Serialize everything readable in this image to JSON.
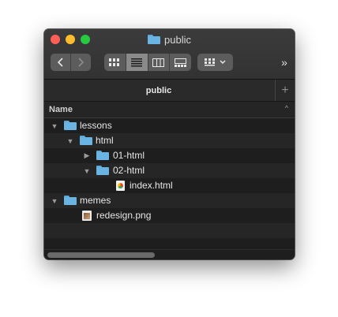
{
  "window": {
    "title": "public"
  },
  "toolbar": {
    "back_icon": "chevron-left-icon",
    "forward_icon": "chevron-right-icon",
    "views": [
      "icon-view-icon",
      "list-view-icon",
      "column-view-icon",
      "gallery-view-icon"
    ],
    "active_view": "list",
    "arrange_icon": "group-icon",
    "more_label": "»"
  },
  "tabbar": {
    "tab_label": "public",
    "add_label": "+"
  },
  "columns": {
    "name_label": "Name"
  },
  "files": [
    {
      "name": "lessons",
      "type": "folder",
      "expanded": true,
      "disclosure": "▼"
    },
    {
      "name": "html",
      "type": "folder",
      "expanded": true,
      "disclosure": "▼"
    },
    {
      "name": "01-html",
      "type": "folder",
      "expanded": false,
      "disclosure": "▶"
    },
    {
      "name": "02-html",
      "type": "folder",
      "expanded": true,
      "disclosure": "▼"
    },
    {
      "name": "index.html",
      "type": "html-file",
      "disclosure": ""
    },
    {
      "name": "memes",
      "type": "folder",
      "expanded": true,
      "disclosure": "▼"
    },
    {
      "name": "redesign.png",
      "type": "image-file",
      "disclosure": ""
    }
  ],
  "colors": {
    "folder": "#6ab4e4",
    "close": "#ff5f57",
    "minimize": "#febc2e",
    "zoom": "#28c840"
  }
}
